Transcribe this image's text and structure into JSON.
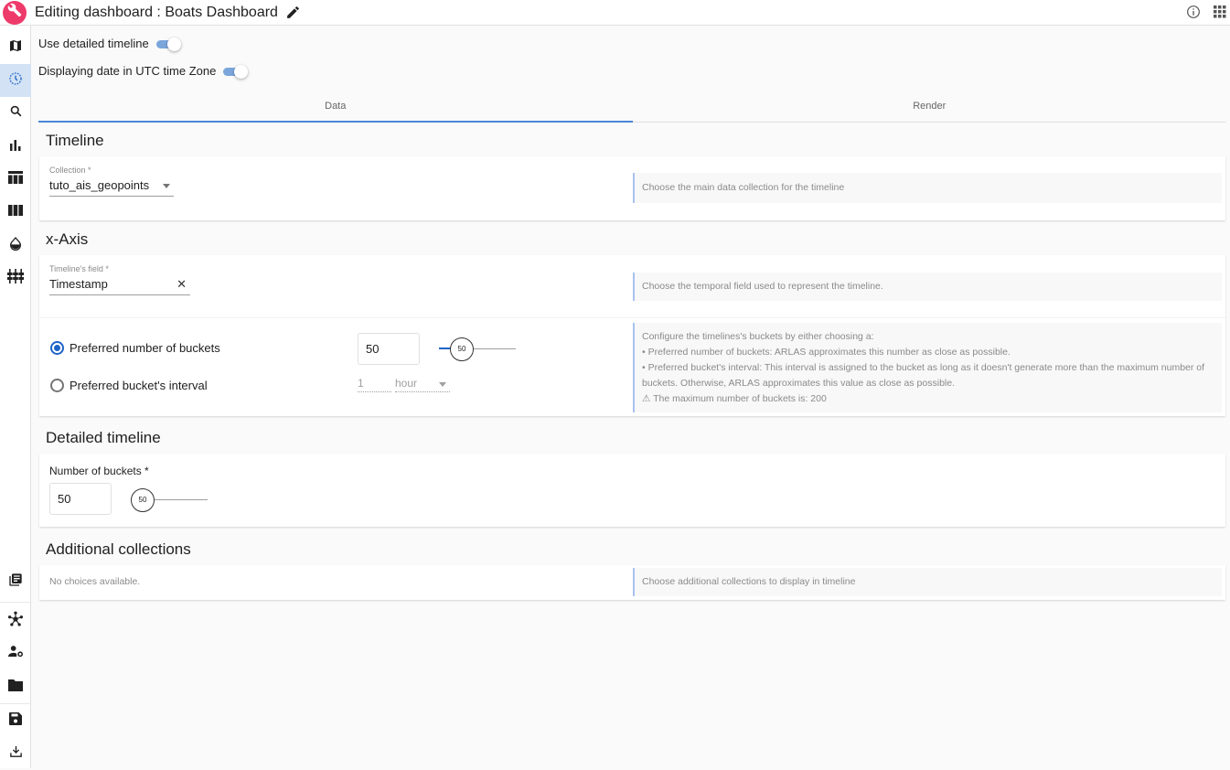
{
  "header": {
    "title": "Editing dashboard : Boats Dashboard",
    "logo_icon": "wrench-icon",
    "edit_icon": "pencil-icon",
    "info_icon": "info-icon",
    "apps_icon": "apps-grid-icon"
  },
  "sidebar": {
    "items": [
      {
        "icon": "map-icon",
        "active": false
      },
      {
        "icon": "timeline-clock-icon",
        "active": true
      },
      {
        "icon": "search-icon",
        "active": false
      },
      {
        "icon": "bar-chart-icon",
        "active": false
      },
      {
        "icon": "table-icon",
        "active": false
      },
      {
        "icon": "columns-icon",
        "active": false
      },
      {
        "icon": "drop-icon",
        "active": false
      },
      {
        "icon": "sliders-icon",
        "active": false
      },
      {
        "icon": "library-icon",
        "active": false
      },
      {
        "icon": "hub-icon",
        "active": false
      },
      {
        "icon": "user-settings-icon",
        "active": false
      },
      {
        "icon": "folder-icon",
        "active": false
      },
      {
        "icon": "save-icon",
        "active": false
      },
      {
        "icon": "download-icon",
        "active": false
      }
    ]
  },
  "toggles": {
    "detailed_timeline": {
      "label": "Use detailed timeline",
      "on": true
    },
    "utc": {
      "label": "Displaying date in UTC time Zone",
      "on": true
    }
  },
  "tabs": [
    {
      "label": "Data",
      "active": true
    },
    {
      "label": "Render",
      "active": false
    }
  ],
  "timeline_section": {
    "title": "Timeline",
    "collection_label": "Collection *",
    "collection_value": "tuto_ais_geopoints",
    "help": "Choose the main data collection for the timeline"
  },
  "xaxis_section": {
    "title": "x-Axis",
    "field_label": "Timeline's field *",
    "field_value": "Timestamp",
    "field_help": "Choose the temporal field used to represent the timeline.",
    "bucket_options": [
      {
        "label": "Preferred number of buckets",
        "checked": true
      },
      {
        "label": "Preferred bucket's interval",
        "checked": false
      }
    ],
    "buckets_value": "50",
    "buckets_slider": {
      "value": 50,
      "min": 0,
      "max": 200
    },
    "interval_value": "1",
    "interval_unit": "hour",
    "bucket_help": [
      "Configure the timelines's buckets by either choosing a:",
      "• Preferred number of buckets: ARLAS approximates this number as close as possible.",
      "• Preferred bucket's interval: This interval is assigned to the bucket as long as it doesn't generate more than the maximum number of buckets. Otherwise, ARLAS approximates this value as close as possible.",
      "⚠ The maximum number of buckets is: 200"
    ]
  },
  "detailed_section": {
    "title": "Detailed timeline",
    "buckets_label": "Number of buckets *",
    "buckets_value": "50",
    "buckets_slider": {
      "value": 50,
      "min": 0,
      "max": 1000
    }
  },
  "additional_section": {
    "title": "Additional collections",
    "empty_text": "No choices available.",
    "help": "Choose additional collections to display in timeline"
  }
}
